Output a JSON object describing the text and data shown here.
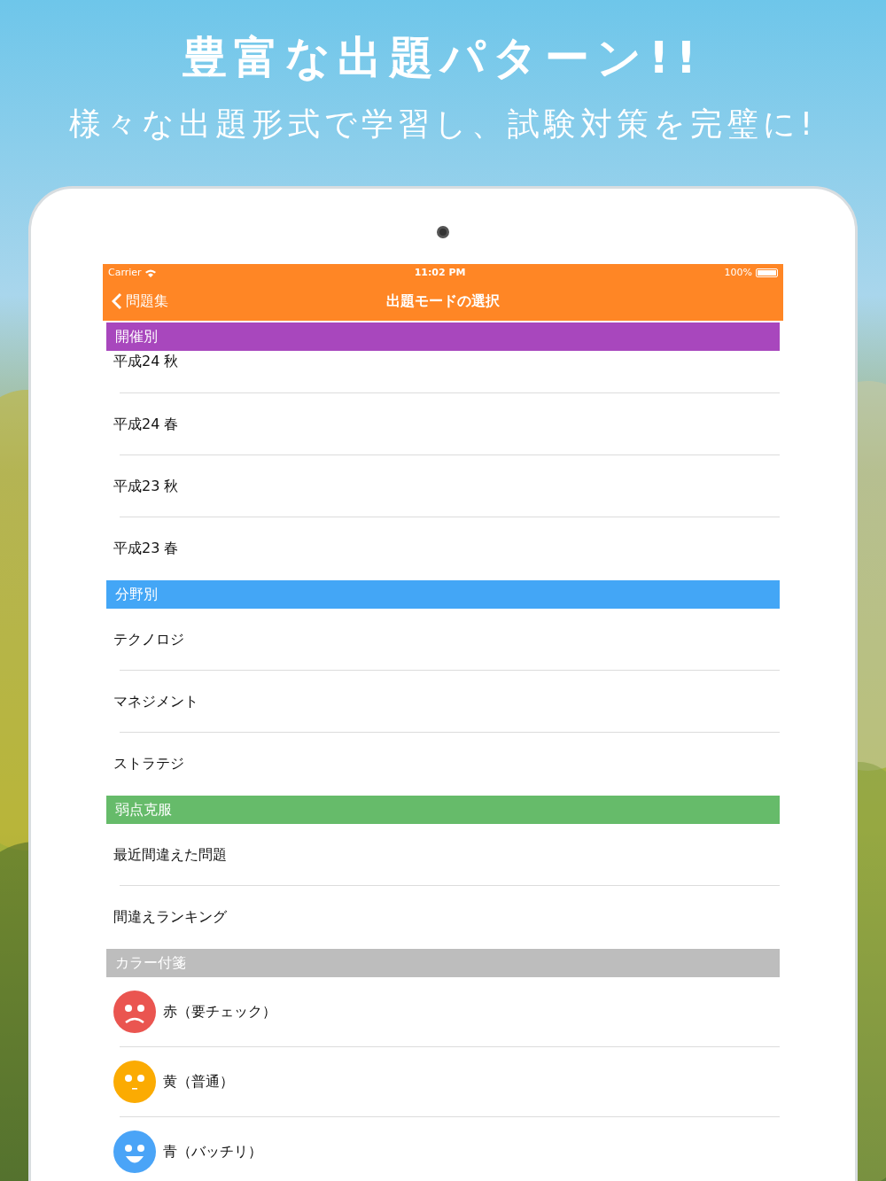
{
  "headline": "豊富な出題パターン!!",
  "subheadline": "様々な出題形式で学習し、試験対策を完璧に!",
  "status_bar": {
    "carrier": "Carrier",
    "time": "11:02 PM",
    "battery": "100%"
  },
  "nav_bar": {
    "back": "問題集",
    "title": "出題モードの選択"
  },
  "sections": [
    {
      "title": "開催別",
      "color": "#a847bd",
      "items": [
        {
          "kind": "text",
          "label": "平成24 秋"
        },
        {
          "kind": "text",
          "label": "平成24 春"
        },
        {
          "kind": "text",
          "label": "平成23 秋"
        },
        {
          "kind": "text",
          "label": "平成23 春"
        }
      ]
    },
    {
      "title": "分野別",
      "color": "#43a6f6",
      "items": [
        {
          "kind": "text",
          "label": "テクノロジ"
        },
        {
          "kind": "text",
          "label": "マネジメント"
        },
        {
          "kind": "text",
          "label": "ストラテジ"
        }
      ]
    },
    {
      "title": "弱点克服",
      "color": "#66bb6a",
      "items": [
        {
          "kind": "text",
          "label": "最近間違えた問題"
        },
        {
          "kind": "text",
          "label": "間違えランキング"
        }
      ]
    },
    {
      "title": "カラー付箋",
      "color": "#bdbdbd",
      "items": [
        {
          "kind": "sad",
          "color": "#ea5550",
          "label": "赤（要チェック）"
        },
        {
          "kind": "neutral",
          "color": "#fbab02",
          "label": "黄（普通）"
        },
        {
          "kind": "happy",
          "color": "#4aa4f7",
          "label": "青（バッチリ）"
        }
      ]
    }
  ]
}
